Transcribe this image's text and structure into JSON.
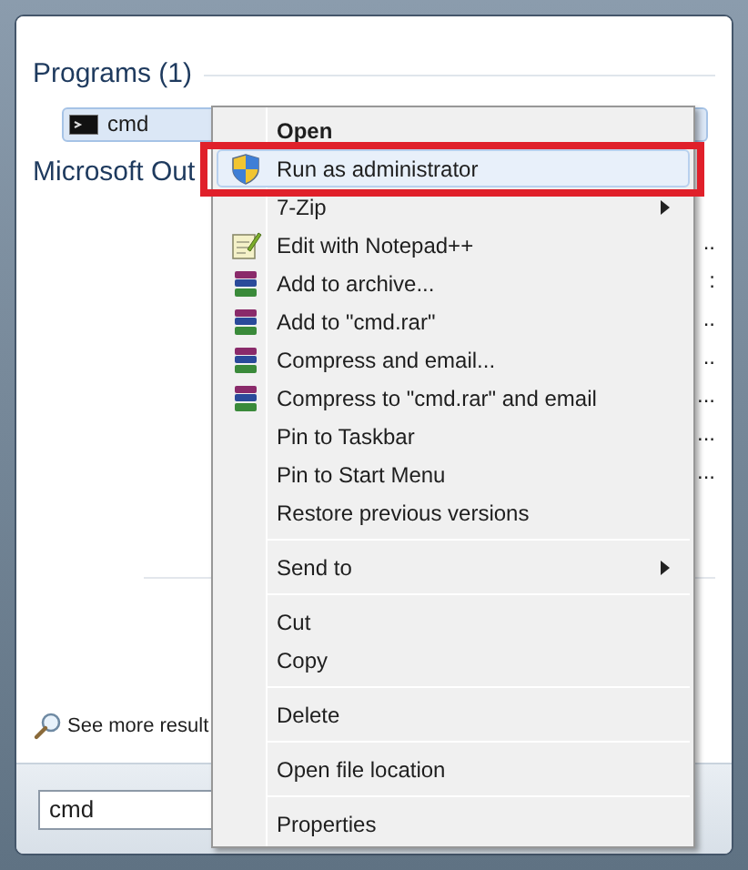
{
  "results": {
    "heading": "Programs (1)",
    "program": {
      "label": "cmd",
      "selected": true
    },
    "partial_item": "Microsoft Out",
    "hidden_row_tails": [
      "..",
      ":",
      "..",
      "..",
      "...",
      "...",
      "..."
    ],
    "see_more": "See more result"
  },
  "search": {
    "value": "cmd"
  },
  "context_menu": {
    "items": [
      {
        "kind": "plain",
        "label": "Open",
        "default": true,
        "selected": false,
        "submenu": false,
        "annotated": false
      },
      {
        "kind": "shield",
        "label": "Run as administrator",
        "default": false,
        "selected": true,
        "submenu": false,
        "annotated": true
      },
      {
        "kind": "plain",
        "label": "7-Zip",
        "default": false,
        "selected": false,
        "submenu": true,
        "annotated": false
      },
      {
        "kind": "editor",
        "label": "Edit with Notepad++",
        "default": false,
        "selected": false,
        "submenu": false,
        "annotated": false
      },
      {
        "kind": "archive",
        "label": "Add to archive...",
        "default": false,
        "selected": false,
        "submenu": false,
        "annotated": false
      },
      {
        "kind": "archive",
        "label": "Add to \"cmd.rar\"",
        "default": false,
        "selected": false,
        "submenu": false,
        "annotated": false
      },
      {
        "kind": "archive",
        "label": "Compress and email...",
        "default": false,
        "selected": false,
        "submenu": false,
        "annotated": false
      },
      {
        "kind": "archive",
        "label": "Compress to \"cmd.rar\" and email",
        "default": false,
        "selected": false,
        "submenu": false,
        "annotated": false
      },
      {
        "kind": "plain",
        "label": "Pin to Taskbar",
        "default": false,
        "selected": false,
        "submenu": false,
        "annotated": false
      },
      {
        "kind": "plain",
        "label": "Pin to Start Menu",
        "default": false,
        "selected": false,
        "submenu": false,
        "annotated": false
      },
      {
        "kind": "plain",
        "label": "Restore previous versions",
        "default": false,
        "selected": false,
        "submenu": false,
        "annotated": false
      },
      {
        "kind": "separator"
      },
      {
        "kind": "plain",
        "label": "Send to",
        "default": false,
        "selected": false,
        "submenu": true,
        "annotated": false
      },
      {
        "kind": "separator"
      },
      {
        "kind": "plain",
        "label": "Cut",
        "default": false,
        "selected": false,
        "submenu": false,
        "annotated": false
      },
      {
        "kind": "plain",
        "label": "Copy",
        "default": false,
        "selected": false,
        "submenu": false,
        "annotated": false
      },
      {
        "kind": "separator"
      },
      {
        "kind": "plain",
        "label": "Delete",
        "default": false,
        "selected": false,
        "submenu": false,
        "annotated": false
      },
      {
        "kind": "separator"
      },
      {
        "kind": "plain",
        "label": "Open file location",
        "default": false,
        "selected": false,
        "submenu": false,
        "annotated": false
      },
      {
        "kind": "separator"
      },
      {
        "kind": "plain",
        "label": "Properties",
        "default": false,
        "selected": false,
        "submenu": false,
        "annotated": false
      }
    ]
  }
}
